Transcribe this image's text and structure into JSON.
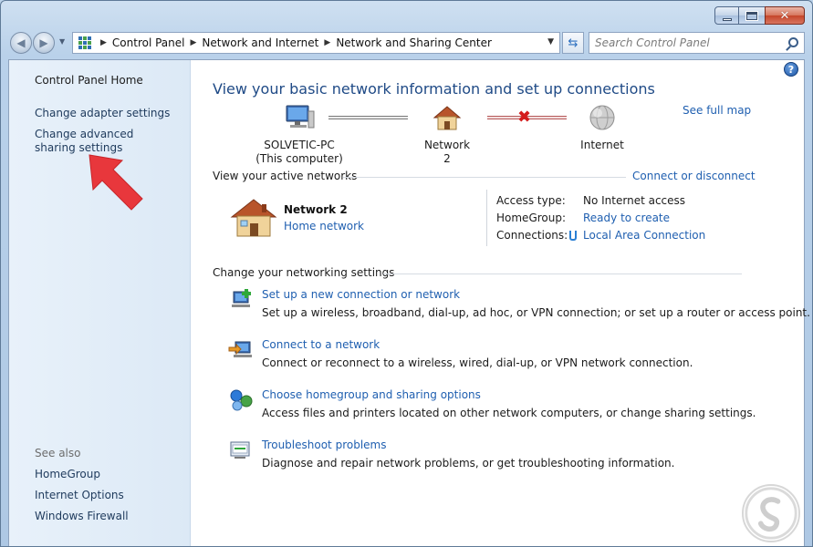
{
  "window": {
    "caption": {
      "minimize": "minimize",
      "maximize": "maximize",
      "close": "close"
    }
  },
  "nav": {
    "breadcrumbs": [
      "Control Panel",
      "Network and Internet",
      "Network and Sharing Center"
    ],
    "search_placeholder": "Search Control Panel"
  },
  "sidebar": {
    "home": "Control Panel Home",
    "links": [
      "Change adapter settings",
      "Change advanced sharing settings"
    ],
    "see_also_label": "See also",
    "see_also": [
      "HomeGroup",
      "Internet Options",
      "Windows Firewall"
    ]
  },
  "main": {
    "title": "View your basic network information and set up connections",
    "see_full_map": "See full map",
    "map": {
      "computer_name": "SOLVETIC-PC",
      "computer_sub": "(This computer)",
      "network": "Network  2",
      "internet": "Internet"
    },
    "active_networks": {
      "heading": "View your active networks",
      "connect_link": "Connect or disconnect",
      "network_name": "Network  2",
      "network_type": "Home network",
      "access_type_label": "Access type:",
      "access_type_value": "No Internet access",
      "homegroup_label": "HomeGroup:",
      "homegroup_value": "Ready to create",
      "connections_label": "Connections:",
      "connections_value": "Local Area Connection"
    },
    "change_settings": {
      "heading": "Change your networking settings",
      "tasks": [
        {
          "link": "Set up a new connection or network",
          "desc": "Set up a wireless, broadband, dial-up, ad hoc, or VPN connection; or set up a router or access point."
        },
        {
          "link": "Connect to a network",
          "desc": "Connect or reconnect to a wireless, wired, dial-up, or VPN network connection."
        },
        {
          "link": "Choose homegroup and sharing options",
          "desc": "Access files and printers located on other network computers, or change sharing settings."
        },
        {
          "link": "Troubleshoot problems",
          "desc": "Diagnose and repair network problems, or get troubleshooting information."
        }
      ]
    }
  },
  "colors": {
    "link": "#1f5fb0",
    "title": "#1f4a86",
    "sidebar_bg": "#dce9f6",
    "arrow": "#e8373c"
  }
}
